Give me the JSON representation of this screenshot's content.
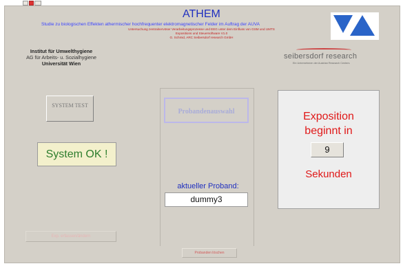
{
  "header": {
    "title": "ATHEM",
    "subtitle": "Studie zu biologischen Effekten athermischer hochfrequenter elektromagnetischer Felder im Auftrag der AUVA",
    "line1": "Untersuchung zentralnervöser Verarbeitungsprozesse und EEG unter dem Einfluss von GSM und UMTS",
    "line2": "Expositions und Steuersoftware V1.0",
    "line3": "G. Schmid, ARC Seibersdorf research GmbH",
    "logo_icon": "auva-logo-icon"
  },
  "institute": {
    "name": "Institut für Umwelthygiene",
    "department": "AG für Arbeits- u. Sozialhygiene",
    "university": "Universität Wien"
  },
  "branding": {
    "name": "seibersdorf research",
    "tagline": "Ein Unternehmen der Austrian Research Centers"
  },
  "system": {
    "test_button": "SYSTEM TEST",
    "status": "System OK !",
    "disabled_button": "Exp. erfassen/ändern"
  },
  "proband": {
    "select_button": "Probandenauswahl",
    "label": "aktueller Proband:",
    "value": "dummy3",
    "bottom_button": "Probanden löschen"
  },
  "exposition": {
    "line1": "Exposition",
    "line2": "beginnt in",
    "countdown": "9",
    "unit": "Sekunden"
  },
  "colors": {
    "panel": "#d4d0c8",
    "title_blue": "#1f2fbf",
    "alert_red": "#e01818",
    "ok_green": "#2d7d2d"
  }
}
